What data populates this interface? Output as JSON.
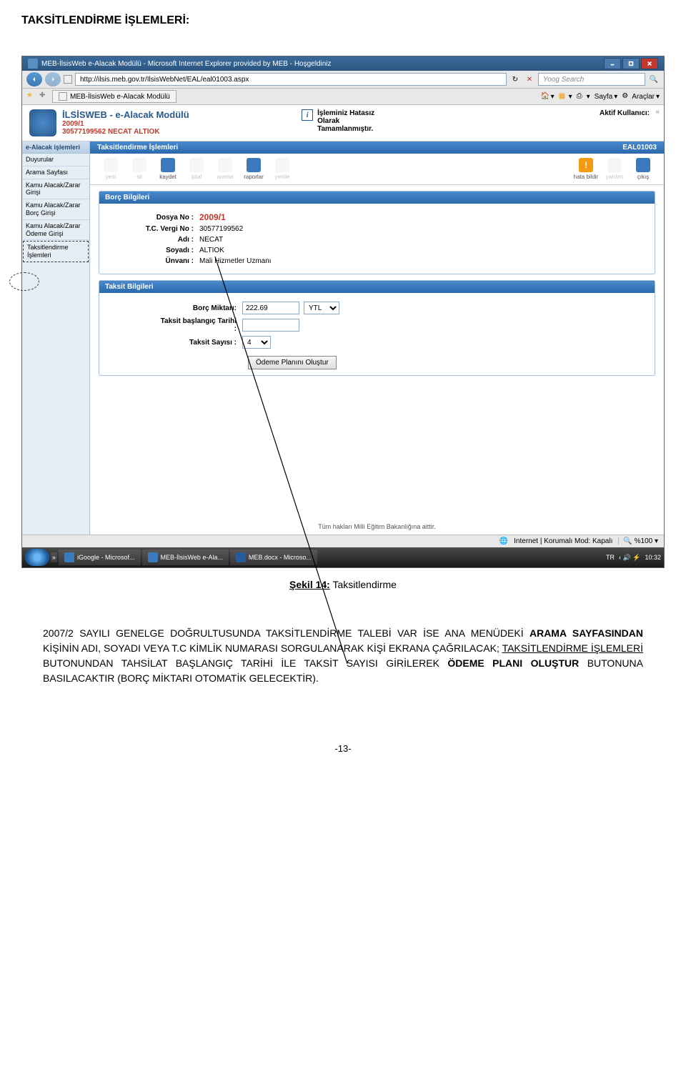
{
  "page_heading": "TAKSİTLENDİRME İŞLEMLERİ:",
  "browser": {
    "title": "MEB-İlsisWeb e-Alacak Modülü - Microsoft Internet Explorer provided by MEB - Hoşgeldiniz",
    "url": "http://ilsis.meb.gov.tr/IlsisWebNet/EAL/eal01003.aspx",
    "search_placeholder": "Yoog Search",
    "tab_label": "MEB-İlsisWeb e-Alacak Modülü",
    "toolbar": {
      "home": "",
      "rss": "",
      "print": "",
      "page": "Sayfa",
      "tools": "Araçlar"
    }
  },
  "app": {
    "title": "İLSİSWEB - e-Alacak Modülü",
    "dosya": "2009/1",
    "ident": "30577199562 NECAT ALTIOK",
    "status_l1": "İşleminiz Hatasız",
    "status_l2": "Olarak",
    "status_l3": "Tamamlanmıştır.",
    "active_user_label": "Aktif Kullanıcı:"
  },
  "sidebar": {
    "header": "e-Alacak işlemleri",
    "items": [
      "Duyurular",
      "Arama Sayfası",
      "Kamu Alacak/Zarar Girişi",
      "Kamu Alacak/Zarar Borç Girişi",
      "Kamu Alacak/Zarar Ödeme Girişi",
      "Taksitlendirme İşlemleri"
    ]
  },
  "workspace": {
    "title": "Taksitlendirme İşlemleri",
    "code": "EAL01003",
    "toolbar": {
      "yeni": "yeni",
      "sil": "sil",
      "kaydet": "kaydet",
      "iptal": "iptal",
      "arama": "arama",
      "raporlar": "raporlar",
      "yenile": "yenile",
      "hata": "hata bildir",
      "yardim": "yardım",
      "cikis": "çıkış"
    }
  },
  "panel1": {
    "title": "Borç Bilgileri",
    "dosya_label": "Dosya No :",
    "dosya_value": "2009/1",
    "tc_label": "T.C. Vergi No :",
    "tc_value": "30577199562",
    "adi_label": "Adı :",
    "adi_value": "NECAT",
    "soyadi_label": "Soyadı :",
    "soyadi_value": "ALTIOK",
    "unvan_label": "Ünvanı :",
    "unvan_value": "Mali Hizmetler Uzmanı"
  },
  "panel2": {
    "title": "Taksit Bilgileri",
    "miktar_label": "Borç Miktarı:",
    "miktar_value": "222.69",
    "currency": "YTL",
    "tarih_label": "Taksit başlangıç Tarihi :",
    "tarih_value": "",
    "sayi_label": "Taksit Sayısı :",
    "sayi_value": "4",
    "btn": "Ödeme Planını Oluştur"
  },
  "footer_note": "Tüm hakları Milli Eğitim Bakanlığına aittir.",
  "status": {
    "internet": "Internet | Korumalı Mod: Kapalı",
    "zoom": "%100",
    "lang": "TR",
    "time": "10:32"
  },
  "taskbar": {
    "t1": "iGoogle - Microsof...",
    "t2": "MEB-İlsisWeb e-Ala...",
    "t3": "MEB.docx - Microso..."
  },
  "figure_caption_prefix": "Şekil 14:",
  "figure_caption_text": " Taksitlendirme",
  "body_text_1": "2007/2 SAYILI GENELGE DOĞRULTUSUNDA TAKSİTLENDİRME TALEBİ VAR İSE ANA MENÜDEKİ ",
  "body_text_bold1": "ARAMA SAYFASINDAN",
  "body_text_2": " KİŞİNİN ADI, SOYADI VEYA T.C KİMLİK NUMARASI SORGULANARAK KİŞİ EKRANA ÇAĞRILACAK; ",
  "body_text_u": "TAKSİTLENDİRME İŞLEMLERİ ",
  "body_text_3": "BUTONUNDAN TAHSİLAT BAŞLANGIÇ TARİHİ İLE TAKSİT SAYISI GİRİLEREK ",
  "body_text_bold2": "ÖDEME PLANI OLUŞTUR",
  "body_text_4": " BUTONUNA BASILACAKTIR (BORÇ MİKTARI OTOMATİK GELECEKTİR).",
  "page_number": "-13-"
}
